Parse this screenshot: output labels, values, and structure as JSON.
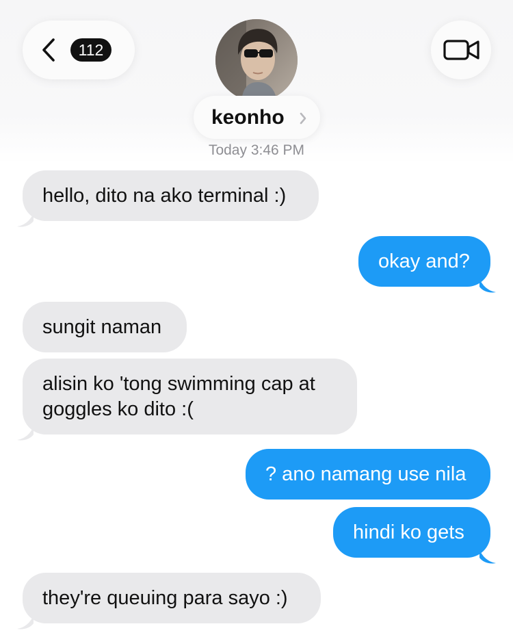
{
  "header": {
    "back_count": "112",
    "contact_name": "keonho",
    "timestamp_day": "Today",
    "timestamp_time": "3:46 PM"
  },
  "colors": {
    "incoming_bubble": "#e9e9eb",
    "outgoing_bubble": "#1d9bf6"
  },
  "icons": {
    "back": "chevron-left-icon",
    "video": "video-camera-icon",
    "name_chevron": "chevron-right-icon"
  },
  "messages": [
    {
      "direction": "in",
      "text": "hello, dito na ako terminal :)"
    },
    {
      "direction": "out",
      "text": "okay and?"
    },
    {
      "direction": "in",
      "text": "sungit naman"
    },
    {
      "direction": "in",
      "line1": "alisin ko 'tong swimming cap at",
      "line2": "goggles ko dito :("
    },
    {
      "direction": "out",
      "text": "? ano namang use nila"
    },
    {
      "direction": "out",
      "text": "hindi ko gets"
    },
    {
      "direction": "in",
      "text": "they're queuing para sayo :)"
    }
  ]
}
